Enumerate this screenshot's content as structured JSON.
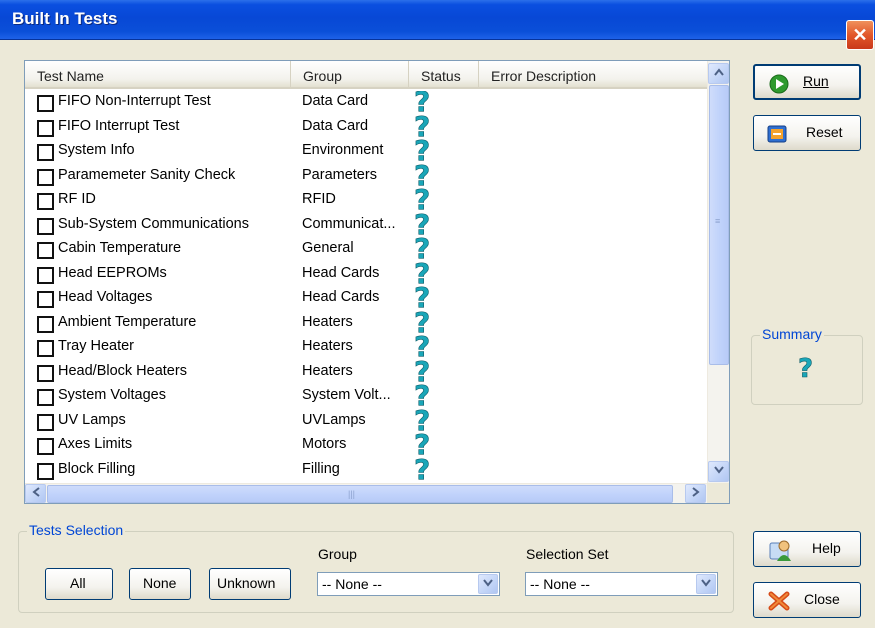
{
  "window": {
    "title": "Built In Tests",
    "close_glyph": "✕"
  },
  "columns": [
    "Test Name",
    "Group",
    "Status",
    "Error Description"
  ],
  "tests": [
    {
      "name": "FIFO Non-Interrupt Test",
      "group": "Data Card",
      "status": "?"
    },
    {
      "name": "FIFO Interrupt Test",
      "group": "Data Card",
      "status": "?"
    },
    {
      "name": "System Info",
      "group": "Environment",
      "status": "?"
    },
    {
      "name": "Paramemeter Sanity Check",
      "group": "Parameters",
      "status": "?"
    },
    {
      "name": "RF ID",
      "group": "RFID",
      "status": "?"
    },
    {
      "name": "Sub-System Communications",
      "group": "Communicat...",
      "status": "?"
    },
    {
      "name": "Cabin Temperature",
      "group": "General",
      "status": "?"
    },
    {
      "name": "Head EEPROMs",
      "group": "Head Cards",
      "status": "?"
    },
    {
      "name": "Head Voltages",
      "group": "Head Cards",
      "status": "?"
    },
    {
      "name": "Ambient Temperature",
      "group": "Heaters",
      "status": "?"
    },
    {
      "name": "Tray Heater",
      "group": "Heaters",
      "status": "?"
    },
    {
      "name": "Head/Block Heaters",
      "group": "Heaters",
      "status": "?"
    },
    {
      "name": "System Voltages",
      "group": "System Volt...",
      "status": "?"
    },
    {
      "name": "UV Lamps",
      "group": "UVLamps",
      "status": "?"
    },
    {
      "name": "Axes Limits",
      "group": "Motors",
      "status": "?"
    },
    {
      "name": "Block Filling",
      "group": "Filling",
      "status": "?"
    }
  ],
  "buttons": {
    "run": "Run",
    "reset": "Reset",
    "help": "Help",
    "close": "Close",
    "all": "All",
    "none": "None",
    "unknown": "Unknown"
  },
  "summary": {
    "title": "Summary",
    "status": "?"
  },
  "tests_selection": {
    "title": "Tests Selection",
    "group_label": "Group",
    "group_value": "-- None --",
    "set_label": "Selection Set",
    "set_value": "-- None --"
  },
  "colors": {
    "title_bar": "#0a4fe0",
    "status_icon": "#1aa6b8",
    "group_title": "#0046d5"
  },
  "icons": {
    "run": "play-icon",
    "reset": "reset-icon",
    "help": "help-person-icon",
    "close": "close-x-icon",
    "status": "question-mark-icon"
  }
}
